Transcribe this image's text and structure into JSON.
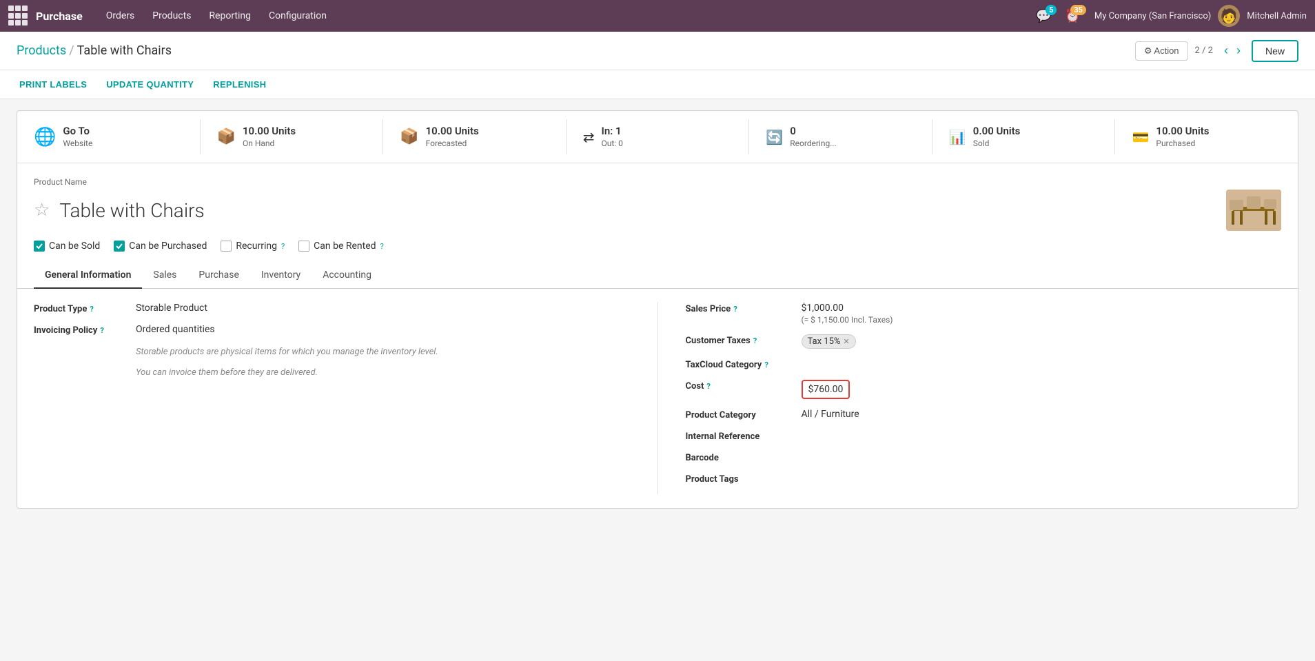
{
  "topnav": {
    "brand": "Purchase",
    "menu_items": [
      "Orders",
      "Products",
      "Reporting",
      "Configuration"
    ],
    "notifications_count": "5",
    "clock_count": "35",
    "company": "My Company (San Francisco)",
    "user": "Mitchell Admin"
  },
  "header": {
    "breadcrumb_parent": "Products",
    "breadcrumb_current": "Table with Chairs",
    "action_label": "⚙ Action",
    "page_counter": "2 / 2",
    "new_label": "New"
  },
  "toolbar": {
    "print_labels": "PRINT LABELS",
    "update_quantity": "UPDATE QUANTITY",
    "replenish": "REPLENISH"
  },
  "stats": [
    {
      "icon": "🌐",
      "value": "Go To",
      "label": "Website",
      "color": "#e53935"
    },
    {
      "icon": "📦",
      "value": "10.00 Units",
      "label": "On Hand",
      "color": "#555"
    },
    {
      "icon": "📦",
      "value": "10.00 Units",
      "label": "Forecasted",
      "color": "#555"
    },
    {
      "icon": "⇄",
      "value_in": "In:  1",
      "value_out": "Out: 0",
      "label": "",
      "color": "#555"
    },
    {
      "icon": "🔄",
      "value": "0",
      "label": "Reordering...",
      "color": "#555"
    },
    {
      "icon": "📊",
      "value": "0.00 Units",
      "label": "Sold",
      "color": "#555"
    },
    {
      "icon": "💳",
      "value": "10.00 Units",
      "label": "Purchased",
      "color": "#555"
    }
  ],
  "product": {
    "name_label": "Product Name",
    "name": "Table with Chairs",
    "starred": false,
    "checkboxes": [
      {
        "id": "can_be_sold",
        "label": "Can be Sold",
        "checked": true
      },
      {
        "id": "can_be_purchased",
        "label": "Can be Purchased",
        "checked": true
      },
      {
        "id": "recurring",
        "label": "Recurring",
        "checked": false
      },
      {
        "id": "can_be_rented",
        "label": "Can be Rented",
        "checked": false
      }
    ],
    "tabs": [
      "General Information",
      "Sales",
      "Purchase",
      "Inventory",
      "Accounting"
    ],
    "active_tab": "General Information"
  },
  "form": {
    "left": {
      "product_type_label": "Product Type",
      "product_type_help": "?",
      "product_type_value": "Storable Product",
      "invoicing_policy_label": "Invoicing Policy",
      "invoicing_policy_help": "?",
      "invoicing_policy_value": "Ordered quantities",
      "note1": "Storable products are physical items for which you manage the inventory level.",
      "note2": "You can invoice them before they are delivered."
    },
    "right": {
      "sales_price_label": "Sales Price",
      "sales_price_help": "?",
      "sales_price_value": "$1,000.00",
      "sales_price_note": "(= $ 1,150.00 Incl. Taxes)",
      "customer_taxes_label": "Customer Taxes",
      "customer_taxes_help": "?",
      "customer_taxes_value": "Tax 15%",
      "taxcloud_label": "TaxCloud Category",
      "taxcloud_help": "?",
      "cost_label": "Cost",
      "cost_help": "?",
      "cost_value": "$760.00",
      "product_category_label": "Product Category",
      "product_category_value": "All / Furniture",
      "internal_reference_label": "Internal Reference",
      "internal_reference_value": "",
      "barcode_label": "Barcode",
      "barcode_value": "",
      "product_tags_label": "Product Tags",
      "product_tags_value": ""
    }
  }
}
